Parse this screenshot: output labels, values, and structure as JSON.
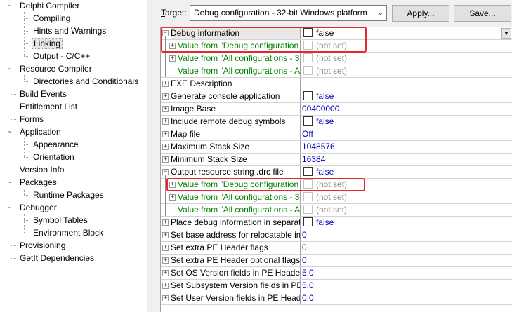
{
  "tree": {
    "items": [
      {
        "label": "Delphi Compiler",
        "level": 0,
        "expandable": true
      },
      {
        "label": "Compiling",
        "level": 1
      },
      {
        "label": "Hints and Warnings",
        "level": 1
      },
      {
        "label": "Linking",
        "level": 1,
        "selected": true
      },
      {
        "label": "Output - C/C++",
        "level": 1
      },
      {
        "label": "Resource Compiler",
        "level": 0,
        "expandable": true
      },
      {
        "label": "Directories and Conditionals",
        "level": 1
      },
      {
        "label": "Build Events",
        "level": 0
      },
      {
        "label": "Entitlement List",
        "level": 0
      },
      {
        "label": "Forms",
        "level": 0
      },
      {
        "label": "Application",
        "level": 0,
        "expandable": true
      },
      {
        "label": "Appearance",
        "level": 1
      },
      {
        "label": "Orientation",
        "level": 1
      },
      {
        "label": "Version Info",
        "level": 0
      },
      {
        "label": "Packages",
        "level": 0,
        "expandable": true
      },
      {
        "label": "Runtime Packages",
        "level": 1
      },
      {
        "label": "Debugger",
        "level": 0,
        "expandable": true
      },
      {
        "label": "Symbol Tables",
        "level": 1
      },
      {
        "label": "Environment Block",
        "level": 1
      },
      {
        "label": "Provisioning",
        "level": 0
      },
      {
        "label": "GetIt Dependencies",
        "level": 0
      }
    ]
  },
  "toolbar": {
    "target_label_prefix": "T",
    "target_label_rest": "arget:",
    "target_value": "Debug configuration - 32-bit Windows platform",
    "apply_label": "Apply...",
    "save_label": "Save..."
  },
  "grid": {
    "rows": [
      {
        "name": "Debug information",
        "value": "false",
        "indent": 0,
        "exp": "minus",
        "checkbox": true,
        "selected": true,
        "dropdown": true,
        "name_color": "black",
        "value_color": "black"
      },
      {
        "name": "Value from \"Debug configuration",
        "value": "(not set)",
        "indent": 1,
        "exp": "plus",
        "checkbox": true,
        "disabled": true,
        "name_color": "green",
        "value_color": "grey"
      },
      {
        "name": "Value from \"All configurations - 3",
        "value": "(not set)",
        "indent": 1,
        "exp": "plus",
        "checkbox": true,
        "disabled": true,
        "name_color": "green",
        "value_color": "grey"
      },
      {
        "name": "Value from \"All configurations - A",
        "value": "(not set)",
        "indent": 1,
        "exp": "none",
        "checkbox": true,
        "disabled": true,
        "name_color": "green",
        "value_color": "grey"
      },
      {
        "name": "EXE Description",
        "value": "",
        "indent": 0,
        "exp": "plus",
        "name_color": "black",
        "value_color": "blue"
      },
      {
        "name": "Generate console application",
        "value": "false",
        "indent": 0,
        "exp": "plus",
        "checkbox": true,
        "name_color": "black",
        "value_color": "blue"
      },
      {
        "name": "Image Base",
        "value": "00400000",
        "indent": 0,
        "exp": "plus",
        "name_color": "black",
        "value_color": "blue"
      },
      {
        "name": "Include remote debug symbols",
        "value": "false",
        "indent": 0,
        "exp": "plus",
        "checkbox": true,
        "name_color": "black",
        "value_color": "blue"
      },
      {
        "name": "Map file",
        "value": "Off",
        "indent": 0,
        "exp": "plus",
        "name_color": "black",
        "value_color": "blue"
      },
      {
        "name": "Maximum Stack Size",
        "value": "1048576",
        "indent": 0,
        "exp": "plus",
        "name_color": "black",
        "value_color": "blue"
      },
      {
        "name": "Minimum Stack Size",
        "value": "16384",
        "indent": 0,
        "exp": "plus",
        "name_color": "black",
        "value_color": "blue"
      },
      {
        "name": "Output resource string .drc file",
        "value": "false",
        "indent": 0,
        "exp": "minus",
        "checkbox": true,
        "name_color": "black",
        "value_color": "blue"
      },
      {
        "name": "Value from \"Debug configuration",
        "value": "(not set)",
        "indent": 1,
        "exp": "plus",
        "checkbox": true,
        "disabled": true,
        "name_color": "green",
        "value_color": "grey"
      },
      {
        "name": "Value from \"All configurations - 3",
        "value": "(not set)",
        "indent": 1,
        "exp": "plus",
        "checkbox": true,
        "disabled": true,
        "name_color": "green",
        "value_color": "grey"
      },
      {
        "name": "Value from \"All configurations - A",
        "value": "(not set)",
        "indent": 1,
        "exp": "none",
        "checkbox": true,
        "disabled": true,
        "name_color": "green",
        "value_color": "grey"
      },
      {
        "name": "Place debug information in separat",
        "value": "false",
        "indent": 0,
        "exp": "plus",
        "checkbox": true,
        "name_color": "black",
        "value_color": "blue"
      },
      {
        "name": "Set base address for relocatable im",
        "value": "0",
        "indent": 0,
        "exp": "plus",
        "name_color": "black",
        "value_color": "blue"
      },
      {
        "name": "Set extra PE Header flags",
        "value": "0",
        "indent": 0,
        "exp": "plus",
        "name_color": "black",
        "value_color": "blue"
      },
      {
        "name": "Set extra PE Header optional flags",
        "value": "0",
        "indent": 0,
        "exp": "plus",
        "name_color": "black",
        "value_color": "blue"
      },
      {
        "name": "Set OS Version fields in PE Header a",
        "value": "5.0",
        "indent": 0,
        "exp": "plus",
        "name_color": "black",
        "value_color": "blue"
      },
      {
        "name": "Set Subsystem Version fields in PE",
        "value": "5.0",
        "indent": 0,
        "exp": "plus",
        "name_color": "black",
        "value_color": "blue"
      },
      {
        "name": "Set User Version fields in PE Heade",
        "value": "0.0",
        "indent": 0,
        "exp": "plus",
        "name_color": "black",
        "value_color": "blue"
      }
    ]
  },
  "colors": {
    "highlight_box": "#e8262e",
    "inherited_text": "#008000",
    "value_text": "#0000c0",
    "not_set_text": "#8a8a8a"
  }
}
